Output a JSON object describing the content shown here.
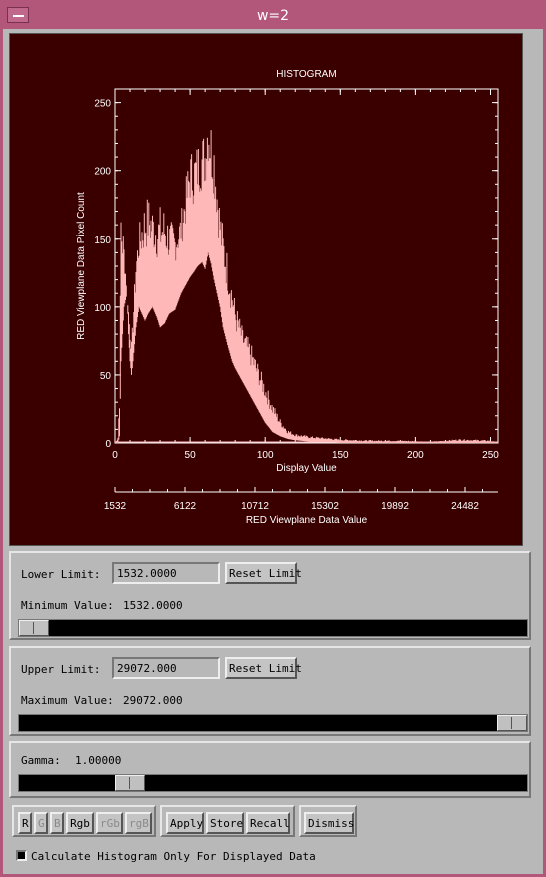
{
  "window": {
    "title": "w=2"
  },
  "chart_data": {
    "type": "line",
    "title": "HISTOGRAM",
    "xlabel": "Display Value",
    "ylabel": "RED Viewplane Data Pixel Count",
    "secondary_xlabel": "RED Viewplane Data Value",
    "xlim": [
      0,
      255
    ],
    "ylim": [
      0,
      260
    ],
    "x_ticks": [
      "0",
      "50",
      "100",
      "150",
      "200",
      "250"
    ],
    "y_ticks": [
      "0",
      "50",
      "100",
      "150",
      "200",
      "250"
    ],
    "secondary_x_ticks": [
      "1532",
      "6122",
      "10712",
      "15302",
      "19892",
      "24482"
    ],
    "colors": {
      "background": "#3a0000",
      "axes": "#ffffff",
      "line": "#ffb8b8"
    },
    "series": [
      {
        "x": [
          0,
          2,
          3,
          4,
          6,
          8,
          9,
          10,
          11,
          12,
          14,
          16,
          18,
          20,
          22,
          25,
          28,
          30,
          33,
          36,
          40,
          44,
          48,
          50,
          52,
          55,
          58,
          60,
          62,
          64,
          66,
          68,
          70,
          72,
          75,
          78,
          80,
          85,
          90,
          95,
          100,
          105,
          110,
          115,
          120,
          130,
          140,
          150,
          170,
          190,
          210,
          230,
          250,
          255
        ],
        "upper": [
          0,
          5,
          40,
          185,
          150,
          110,
          100,
          85,
          75,
          95,
          140,
          160,
          170,
          180,
          182,
          175,
          170,
          175,
          175,
          165,
          160,
          170,
          200,
          218,
          215,
          222,
          228,
          233,
          256,
          240,
          230,
          200,
          175,
          160,
          140,
          120,
          105,
          85,
          75,
          60,
          45,
          30,
          18,
          10,
          7,
          5,
          4,
          3,
          2,
          2,
          1,
          3,
          2,
          0
        ],
        "lower": [
          0,
          0,
          5,
          60,
          100,
          110,
          80,
          60,
          50,
          60,
          85,
          100,
          95,
          90,
          95,
          100,
          92,
          85,
          88,
          95,
          98,
          110,
          118,
          122,
          125,
          130,
          133,
          128,
          140,
          132,
          120,
          110,
          100,
          85,
          72,
          60,
          55,
          45,
          35,
          25,
          15,
          8,
          5,
          3,
          2,
          1,
          1,
          0,
          0,
          0,
          0,
          0,
          0,
          0
        ]
      }
    ]
  },
  "lower_panel": {
    "label": "Lower Limit:",
    "value": "1532.0000",
    "reset_label": "Reset Limit",
    "info_label": "Minimum Value:",
    "info_value": "1532.0000",
    "slider_value": 0.0
  },
  "upper_panel": {
    "label": "Upper Limit:",
    "value": "29072.000",
    "reset_label": "Reset Limit",
    "info_label": "Maximum Value:",
    "info_value": "29072.000",
    "slider_value": 1.0
  },
  "gamma_panel": {
    "label": "Gamma:",
    "value": "1.00000",
    "slider_value": 0.2
  },
  "toolbar": {
    "r": "R",
    "g": "G",
    "b": "B",
    "rgb": "Rgb",
    "rgb_dim1": "rGb",
    "rgb_dim2": "rgB",
    "apply": "Apply",
    "store": "Store",
    "recall": "Recall",
    "dismiss": "Dismiss"
  },
  "footer": {
    "checkbox_label": "Calculate Histogram Only For Displayed Data",
    "checked": true
  }
}
